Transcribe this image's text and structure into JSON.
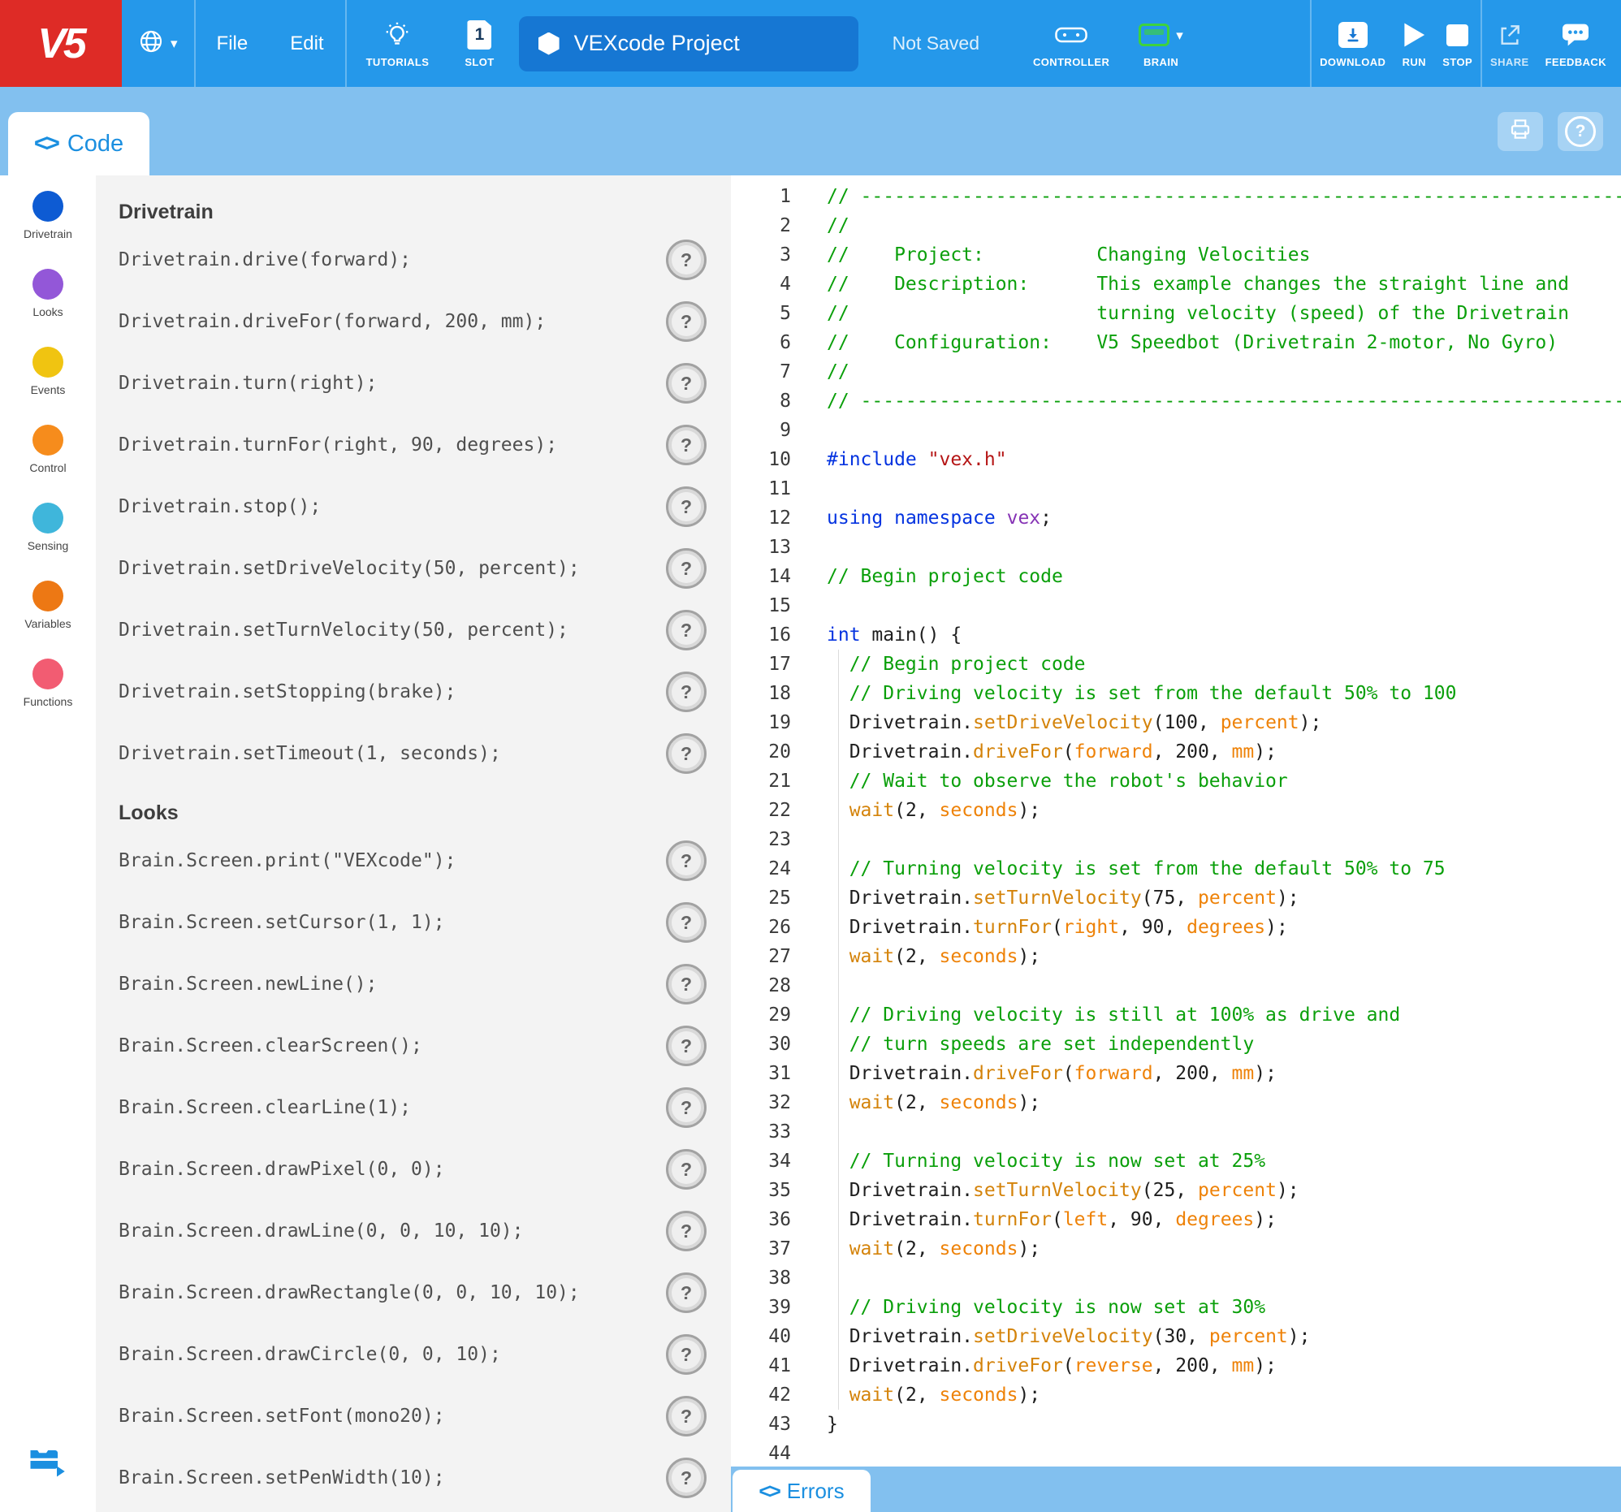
{
  "colors": {
    "topbar": "#2598EA",
    "band": "#82C0EF",
    "logo_bg": "#DE2B26",
    "pill_bg": "#1677D3",
    "accent_blue": "#1B8FE0",
    "brain_green": "#3ED23E",
    "tokens": {
      "p": "#1E1E1E",
      "c": "#0A9F0A",
      "k": "#0433E0",
      "s": "#B51515",
      "ns": "#8633B5",
      "f": "#D4830A",
      "o": "#EE8208",
      "d": "#1E1E1E"
    }
  },
  "toolbar": {
    "logo": "V5",
    "menus": [
      {
        "label": "File"
      },
      {
        "label": "Edit"
      }
    ],
    "tutorials_label": "TUTORIALS",
    "slot_label": "SLOT",
    "slot_number": "1",
    "project_name": "VEXcode Project",
    "save_status": "Not Saved",
    "controller_label": "CONTROLLER",
    "brain_label": "BRAIN",
    "download_label": "DOWNLOAD",
    "run_label": "RUN",
    "stop_label": "STOP",
    "share_label": "SHARE",
    "feedback_label": "FEEDBACK"
  },
  "tabband": {
    "code_tab": "Code",
    "code_icon": "<>",
    "help_glyph": "?"
  },
  "sidebar": {
    "items": [
      {
        "label": "Drivetrain",
        "color": "#0D5BD3"
      },
      {
        "label": "Looks",
        "color": "#9357D8"
      },
      {
        "label": "Events",
        "color": "#F0C411"
      },
      {
        "label": "Control",
        "color": "#F68C1C"
      },
      {
        "label": "Sensing",
        "color": "#3FB6DB"
      },
      {
        "label": "Variables",
        "color": "#ED7814"
      },
      {
        "label": "Functions",
        "color": "#F25C72"
      }
    ]
  },
  "commands": {
    "help_glyph": "?",
    "sections": [
      {
        "title": "Drivetrain",
        "items": [
          "Drivetrain.drive(forward);",
          "Drivetrain.driveFor(forward, 200, mm);",
          "Drivetrain.turn(right);",
          "Drivetrain.turnFor(right, 90, degrees);",
          "Drivetrain.stop();",
          "Drivetrain.setDriveVelocity(50, percent);",
          "Drivetrain.setTurnVelocity(50, percent);",
          "Drivetrain.setStopping(brake);",
          "Drivetrain.setTimeout(1, seconds);"
        ]
      },
      {
        "title": "Looks",
        "items": [
          "Brain.Screen.print(\"VEXcode\");",
          "Brain.Screen.setCursor(1, 1);",
          "Brain.Screen.newLine();",
          "Brain.Screen.clearScreen();",
          "Brain.Screen.clearLine(1);",
          "Brain.Screen.drawPixel(0, 0);",
          "Brain.Screen.drawLine(0, 0, 10, 10);",
          "Brain.Screen.drawRectangle(0, 0, 10, 10);",
          "Brain.Screen.drawCircle(0, 0, 10);",
          "Brain.Screen.setFont(mono20);",
          "Brain.Screen.setPenWidth(10);"
        ]
      }
    ]
  },
  "editor": {
    "lines": [
      [
        [
          "// -----------------------------------------------------------------------------------------",
          "c"
        ]
      ],
      [
        [
          "//",
          "c"
        ]
      ],
      [
        [
          "//    Project:          Changing Velocities",
          "c"
        ]
      ],
      [
        [
          "//    Description:      This example changes the straight line and",
          "c"
        ]
      ],
      [
        [
          "//                      turning velocity (speed) of the Drivetrain",
          "c"
        ]
      ],
      [
        [
          "//    Configuration:    V5 Speedbot (Drivetrain 2-motor, No Gyro)",
          "c"
        ]
      ],
      [
        [
          "//",
          "c"
        ]
      ],
      [
        [
          "// -----------------------------------------------------------------------------------------",
          "c"
        ]
      ],
      [],
      [
        [
          "#include",
          "k"
        ],
        [
          " ",
          "p"
        ],
        [
          "\"vex.h\"",
          "s"
        ]
      ],
      [],
      [
        [
          "using",
          "k"
        ],
        [
          " ",
          "p"
        ],
        [
          "namespace",
          "k"
        ],
        [
          " ",
          "p"
        ],
        [
          "vex",
          "ns"
        ],
        [
          ";",
          "p"
        ]
      ],
      [],
      [
        [
          "// Begin project code",
          "c"
        ]
      ],
      [],
      [
        [
          "int",
          "k"
        ],
        [
          " main() {",
          "p"
        ]
      ],
      [
        [
          "  // Begin project code",
          "c"
        ]
      ],
      [
        [
          "  // Driving velocity is set from the default 50% to 100",
          "c"
        ]
      ],
      [
        [
          "  Drivetrain.",
          "p"
        ],
        [
          "setDriveVelocity",
          "f"
        ],
        [
          "(",
          "p"
        ],
        [
          "100",
          "d"
        ],
        [
          ", ",
          "p"
        ],
        [
          "percent",
          "o"
        ],
        [
          ");",
          "p"
        ]
      ],
      [
        [
          "  Drivetrain.",
          "p"
        ],
        [
          "driveFor",
          "f"
        ],
        [
          "(",
          "p"
        ],
        [
          "forward",
          "o"
        ],
        [
          ", ",
          "p"
        ],
        [
          "200",
          "d"
        ],
        [
          ", ",
          "p"
        ],
        [
          "mm",
          "o"
        ],
        [
          ");",
          "p"
        ]
      ],
      [
        [
          "  // Wait to observe the robot's behavior",
          "c"
        ]
      ],
      [
        [
          "  ",
          "p"
        ],
        [
          "wait",
          "f"
        ],
        [
          "(",
          "p"
        ],
        [
          "2",
          "d"
        ],
        [
          ", ",
          "p"
        ],
        [
          "seconds",
          "o"
        ],
        [
          ");",
          "p"
        ]
      ],
      [],
      [
        [
          "  // Turning velocity is set from the default 50% to 75",
          "c"
        ]
      ],
      [
        [
          "  Drivetrain.",
          "p"
        ],
        [
          "setTurnVelocity",
          "f"
        ],
        [
          "(",
          "p"
        ],
        [
          "75",
          "d"
        ],
        [
          ", ",
          "p"
        ],
        [
          "percent",
          "o"
        ],
        [
          ");",
          "p"
        ]
      ],
      [
        [
          "  Drivetrain.",
          "p"
        ],
        [
          "turnFor",
          "f"
        ],
        [
          "(",
          "p"
        ],
        [
          "right",
          "o"
        ],
        [
          ", ",
          "p"
        ],
        [
          "90",
          "d"
        ],
        [
          ", ",
          "p"
        ],
        [
          "degrees",
          "o"
        ],
        [
          ");",
          "p"
        ]
      ],
      [
        [
          "  ",
          "p"
        ],
        [
          "wait",
          "f"
        ],
        [
          "(",
          "p"
        ],
        [
          "2",
          "d"
        ],
        [
          ", ",
          "p"
        ],
        [
          "seconds",
          "o"
        ],
        [
          ");",
          "p"
        ]
      ],
      [],
      [
        [
          "  // Driving velocity is still at 100% as drive and",
          "c"
        ]
      ],
      [
        [
          "  // turn speeds are set independently",
          "c"
        ]
      ],
      [
        [
          "  Drivetrain.",
          "p"
        ],
        [
          "driveFor",
          "f"
        ],
        [
          "(",
          "p"
        ],
        [
          "forward",
          "o"
        ],
        [
          ", ",
          "p"
        ],
        [
          "200",
          "d"
        ],
        [
          ", ",
          "p"
        ],
        [
          "mm",
          "o"
        ],
        [
          ");",
          "p"
        ]
      ],
      [
        [
          "  ",
          "p"
        ],
        [
          "wait",
          "f"
        ],
        [
          "(",
          "p"
        ],
        [
          "2",
          "d"
        ],
        [
          ", ",
          "p"
        ],
        [
          "seconds",
          "o"
        ],
        [
          ");",
          "p"
        ]
      ],
      [],
      [
        [
          "  // Turning velocity is now set at 25%",
          "c"
        ]
      ],
      [
        [
          "  Drivetrain.",
          "p"
        ],
        [
          "setTurnVelocity",
          "f"
        ],
        [
          "(",
          "p"
        ],
        [
          "25",
          "d"
        ],
        [
          ", ",
          "p"
        ],
        [
          "percent",
          "o"
        ],
        [
          ");",
          "p"
        ]
      ],
      [
        [
          "  Drivetrain.",
          "p"
        ],
        [
          "turnFor",
          "f"
        ],
        [
          "(",
          "p"
        ],
        [
          "left",
          "o"
        ],
        [
          ", ",
          "p"
        ],
        [
          "90",
          "d"
        ],
        [
          ", ",
          "p"
        ],
        [
          "degrees",
          "o"
        ],
        [
          ");",
          "p"
        ]
      ],
      [
        [
          "  ",
          "p"
        ],
        [
          "wait",
          "f"
        ],
        [
          "(",
          "p"
        ],
        [
          "2",
          "d"
        ],
        [
          ", ",
          "p"
        ],
        [
          "seconds",
          "o"
        ],
        [
          ");",
          "p"
        ]
      ],
      [],
      [
        [
          "  // Driving velocity is now set at 30%",
          "c"
        ]
      ],
      [
        [
          "  Drivetrain.",
          "p"
        ],
        [
          "setDriveVelocity",
          "f"
        ],
        [
          "(",
          "p"
        ],
        [
          "30",
          "d"
        ],
        [
          ", ",
          "p"
        ],
        [
          "percent",
          "o"
        ],
        [
          ");",
          "p"
        ]
      ],
      [
        [
          "  Drivetrain.",
          "p"
        ],
        [
          "driveFor",
          "f"
        ],
        [
          "(",
          "p"
        ],
        [
          "reverse",
          "o"
        ],
        [
          ", ",
          "p"
        ],
        [
          "200",
          "d"
        ],
        [
          ", ",
          "p"
        ],
        [
          "mm",
          "o"
        ],
        [
          ");",
          "p"
        ]
      ],
      [
        [
          "  ",
          "p"
        ],
        [
          "wait",
          "f"
        ],
        [
          "(",
          "p"
        ],
        [
          "2",
          "d"
        ],
        [
          ", ",
          "p"
        ],
        [
          "seconds",
          "o"
        ],
        [
          ");",
          "p"
        ]
      ],
      [
        [
          "}",
          "p"
        ]
      ],
      []
    ]
  },
  "bottombar": {
    "errors_tab": "Errors",
    "errors_icon": "<>"
  }
}
